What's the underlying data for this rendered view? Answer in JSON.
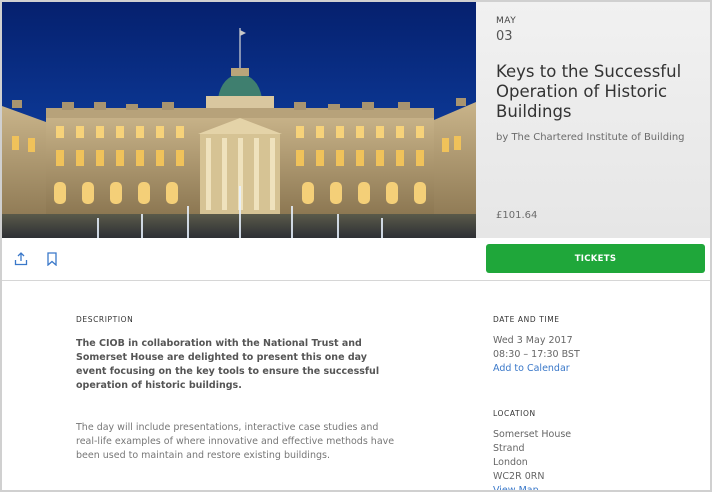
{
  "hero": {
    "image": "Somerset House courtyard at dusk"
  },
  "event": {
    "month": "MAY",
    "day": "03",
    "title": "Keys to the Successful Operation of Historic Buildings",
    "organizer": "by The Chartered Institute of Building",
    "price": "£101.64"
  },
  "actions": {
    "share_icon": "share-icon",
    "bookmark_icon": "bookmark-icon",
    "tickets_label": "TICKETS",
    "accent_color": "#1fa73a"
  },
  "description": {
    "heading": "DESCRIPTION",
    "lead": "The CIOB in collaboration with the National Trust and Somerset House are delighted to present this one day event focusing on the key tools to ensure the successful operation of historic buildings.",
    "body": "The day will include presentations, interactive case studies and real-life examples of where innovative and effective methods have been used to maintain and restore existing buildings."
  },
  "date_time": {
    "heading": "DATE AND TIME",
    "date": "Wed 3 May 2017",
    "time": "08:30 – 17:30 BST",
    "calendar_link": "Add to Calendar"
  },
  "location": {
    "heading": "LOCATION",
    "lines": [
      "Somerset House",
      "Strand",
      "London",
      "WC2R 0RN"
    ],
    "map_link": "View Map",
    "link_color": "#3a78c9"
  }
}
